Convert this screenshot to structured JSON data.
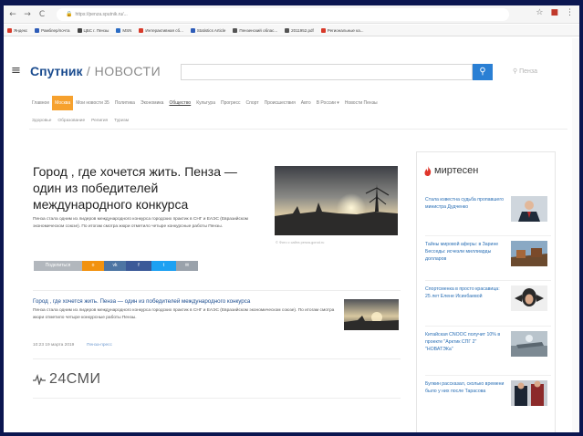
{
  "browser": {
    "url": "https://penza.sputnik.ru/..."
  },
  "bookmarks": [
    {
      "label": "Яндекс",
      "color": "#d83a2a"
    },
    {
      "label": "Рамблер/почта",
      "color": "#2e5cb8"
    },
    {
      "label": "ЦБС г. Пензы",
      "color": "#444444"
    },
    {
      "label": "MSN",
      "color": "#2b6cc4"
    },
    {
      "label": "Интерактивная сб...",
      "color": "#d83a2a"
    },
    {
      "label": "Statistics Article",
      "color": "#2e5cb8"
    },
    {
      "label": "Пензенский облас...",
      "color": "#555555"
    },
    {
      "label": "2011952.pdf",
      "color": "#555555"
    },
    {
      "label": "Региональные ка...",
      "color": "#d83a2a"
    }
  ],
  "header": {
    "brand": "Спутник",
    "divider": " / ",
    "section": "НОВОСТИ",
    "search_placeholder": "",
    "region": "Пенза"
  },
  "nav": {
    "items": [
      {
        "label": "Главное",
        "state": ""
      },
      {
        "label": "Москва",
        "state": "active"
      },
      {
        "label": "Мои новости 35",
        "state": ""
      },
      {
        "label": "Политика",
        "state": ""
      },
      {
        "label": "Экономика",
        "state": ""
      },
      {
        "label": "Общество",
        "state": "underlined"
      },
      {
        "label": "Культура",
        "state": ""
      },
      {
        "label": "Прогресс",
        "state": ""
      },
      {
        "label": "Спорт",
        "state": ""
      },
      {
        "label": "Происшествия",
        "state": ""
      },
      {
        "label": "Авто",
        "state": ""
      },
      {
        "label": "В России ▾",
        "state": ""
      },
      {
        "label": "Новости Пензы",
        "state": ""
      }
    ],
    "sub": [
      "Здоровье",
      "Образование",
      "Религия",
      "Туризм"
    ]
  },
  "main_article": {
    "title": "Город , где хочется жить. Пенза — один из победителей международного конкурса",
    "lead": "Пенза стала одним из лидеров международного конкурса городских практик в СНГ и ЕАЭС (Евразийском экономическом союзе). По итогам смотра жюри отметило четыре конкурсные работы Пензы.",
    "caption": "© Фото с сайта penza-gorod.ru",
    "share": {
      "label": "Поделиться",
      "ok": "о",
      "vk": "vk",
      "fb": "f",
      "tw": "t",
      "email": "✉"
    }
  },
  "second_article": {
    "title": "Город , где хочется жить. Пенза — один из победителей международного конкурса",
    "lead": "Пенза стала одним из лидеров международного конкурса городских практик в СНГ и ЕАЭС (Евразийском экономическом союзе). По итогам смотра жюри отметило четыре конкурсные работы Пензы.",
    "date": "10:23 19 марта 2019",
    "source": "Пенза-пресс"
  },
  "smi": {
    "label": "24СМИ"
  },
  "widget": {
    "title": "миртесен",
    "items": [
      {
        "text": "Стала известна судьба пропавшего министра Дудченко"
      },
      {
        "text": "Тайны мировой аферы: в Зарине Бесседы: исчезли миллиарды долларов"
      },
      {
        "text": "Спортсменка в просто красавица: 25 лет Елене Исинбаевой"
      },
      {
        "text": "Китайская CNOOC получит 10% в проекте \"Арктик СПГ 2\" \"НОВАТЭКа\""
      },
      {
        "text": "Булкин рассказал, сколько времени было у них после Тарасова"
      }
    ]
  },
  "colors": {
    "accent_orange": "#f6a12e",
    "brand_blue": "#1b4c8f",
    "link_blue": "#2a6fb5",
    "search_blue": "#2a7fd4",
    "widget_flame": "#e0352b"
  }
}
